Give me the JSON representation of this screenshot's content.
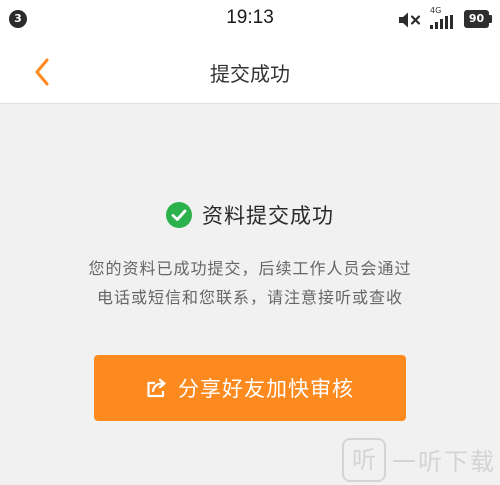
{
  "status_bar": {
    "notification_count": "3",
    "time": "19:13",
    "network_type": "4G",
    "battery_level": "90",
    "icons": [
      "mute-icon",
      "signal-icon",
      "battery-icon"
    ]
  },
  "nav": {
    "back_icon": "chevron-left-icon",
    "title": "提交成功"
  },
  "content": {
    "success_icon": "check-circle-icon",
    "success_title": "资料提交成功",
    "description_line1": "您的资料已成功提交，后续工作人员会通过",
    "description_line2": "电话或短信和您联系，请注意接听或查收"
  },
  "share_button": {
    "icon": "share-icon",
    "label": "分享好友加快审核"
  },
  "watermark": {
    "logo_char": "听",
    "text": "一听下载"
  },
  "colors": {
    "accent": "#fd8a1f",
    "success": "#2bb24c",
    "background": "#f1f1f1",
    "text_primary": "#2a2a2a",
    "text_secondary": "#666666"
  }
}
